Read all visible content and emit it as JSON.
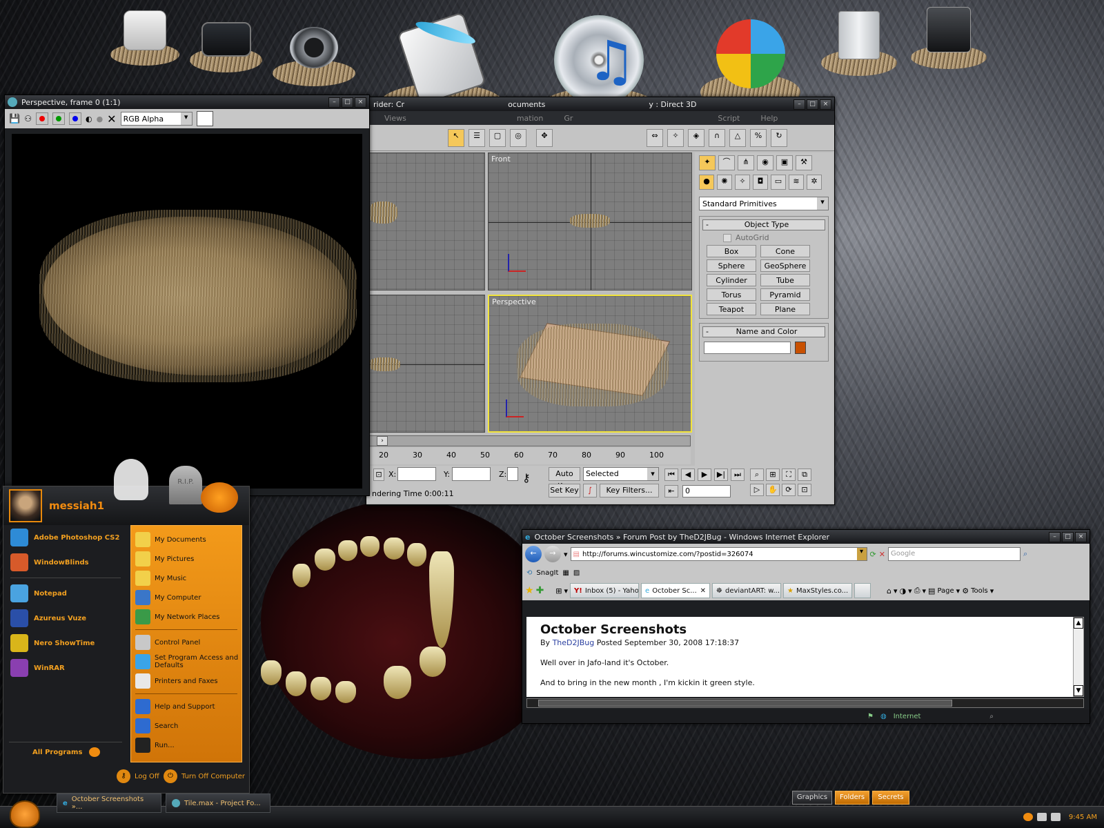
{
  "desktop": {
    "wallpaper": "werewolf-fur-fangs",
    "accent": "#e8890c"
  },
  "dock": {
    "icons": [
      "hard-drive",
      "monitor",
      "3dsmax",
      "feather-document",
      "itunes",
      "windows-media",
      "recycle-bin",
      "external-drive"
    ]
  },
  "render_window": {
    "title": "Perspective, frame 0 (1:1)",
    "channel": "RGB Alpha",
    "tools": [
      "save-icon",
      "clone-icon",
      "red-channel",
      "green-channel",
      "blue-channel",
      "mono-icon",
      "alpha-icon",
      "clear-icon"
    ]
  },
  "max_window": {
    "title_fragments": [
      "rider: Cr",
      "ocuments",
      "y : Direct 3D"
    ],
    "menu": [
      "Views",
      "mation",
      "Gr",
      "Script",
      "Help"
    ],
    "viewports": {
      "front": "Front",
      "perspective": "Perspective"
    },
    "panel": {
      "dropdown": "Standard Primitives",
      "object_type_header": "Object Type",
      "autogrid": "AutoGrid",
      "primitives": [
        "Box",
        "Cone",
        "Sphere",
        "GeoSphere",
        "Cylinder",
        "Tube",
        "Torus",
        "Pyramid",
        "Teapot",
        "Plane"
      ],
      "name_color_header": "Name and Color",
      "swatch": "#c85000"
    },
    "timeline": {
      "ticks": [
        "20",
        "30",
        "40",
        "50",
        "60",
        "70",
        "80",
        "90",
        "100"
      ]
    },
    "status": {
      "x_label": "X:",
      "y_label": "Y:",
      "z_label": "Z:",
      "auto_key": "Auto Key",
      "set_key": "Set Key",
      "selected": "Selected",
      "key_filters": "Key Filters...",
      "rendering_time": "ndering Time  0:00:11",
      "frame": "0"
    }
  },
  "start_menu": {
    "username": "messiah1",
    "pinned": [
      {
        "label": "Adobe Photoshop CS2",
        "icon": "feather-icon"
      },
      {
        "label": "WindowBlinds",
        "icon": "palette-icon"
      }
    ],
    "recent": [
      {
        "label": "Notepad",
        "icon": "notepad-icon"
      },
      {
        "label": "Azureus Vuze",
        "icon": "frog-icon"
      },
      {
        "label": "Nero ShowTime",
        "icon": "disc-icon"
      },
      {
        "label": "WinRAR",
        "icon": "books-icon"
      }
    ],
    "all_programs": "All Programs",
    "right": [
      {
        "label": "My Documents",
        "icon": "folder-icon"
      },
      {
        "label": "My Pictures",
        "icon": "folder-icon"
      },
      {
        "label": "My Music",
        "icon": "folder-icon"
      },
      {
        "label": "My Computer",
        "icon": "monitor-icon"
      },
      {
        "label": "My Network Places",
        "icon": "network-icon"
      }
    ],
    "right2": [
      {
        "label": "Control Panel",
        "icon": "control-panel-icon"
      },
      {
        "label": "Set Program Access and Defaults",
        "icon": "windows-icon"
      },
      {
        "label": "Printers and Faxes",
        "icon": "printer-icon"
      }
    ],
    "right3": [
      {
        "label": "Help and Support",
        "icon": "help-icon"
      },
      {
        "label": "Search",
        "icon": "search-icon"
      },
      {
        "label": "Run...",
        "icon": "run-icon"
      }
    ],
    "log_off": "Log Off",
    "turn_off": "Turn Off Computer",
    "decor": "R.I.P."
  },
  "ie": {
    "title": "October Screenshots » Forum Post by TheD2JBug - Windows Internet Explorer",
    "url": "http://forums.wincustomize.com/?postid=326074",
    "search_placeholder": "Google",
    "snagit": "SnagIt",
    "tabs": [
      "Inbox (5) - Yaho...",
      "October Sc...",
      "deviantART: w...",
      "MaxStyles.co..."
    ],
    "page_label": "Page",
    "tools_label": "Tools",
    "content": {
      "heading": "October Screenshots",
      "by": "By",
      "author": "TheD2JBug",
      "posted": "Posted September 30, 2008 17:18:37",
      "p1": "Well over in Jafo-land it's October.",
      "p2": "And to bring in the new month , I'm kickin it green style."
    },
    "status_zone": "Internet"
  },
  "taskbar": {
    "buttons": [
      "October Screenshots »...",
      "Tile.max    - Project Fo..."
    ],
    "toolbar": [
      "Graphics",
      "Folders",
      "Secrets"
    ],
    "clock": "9:45 AM"
  }
}
